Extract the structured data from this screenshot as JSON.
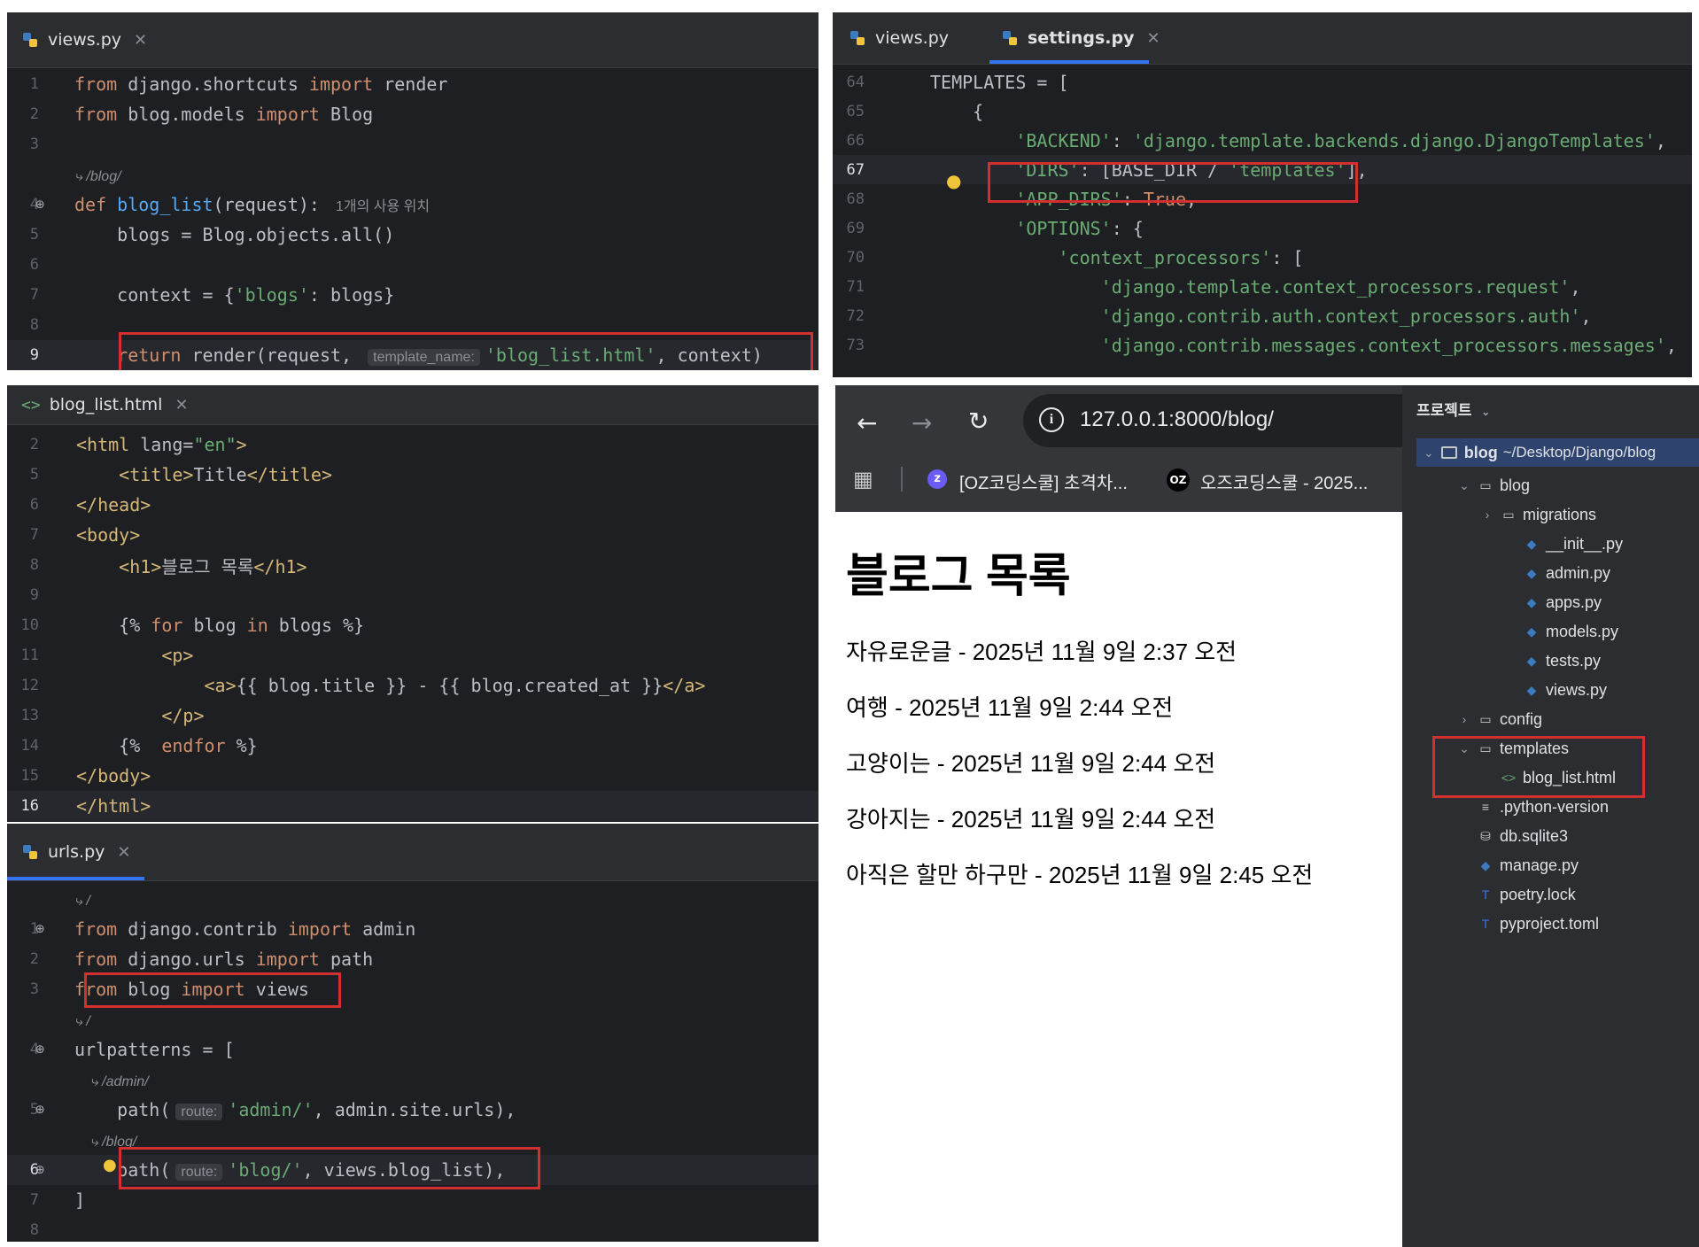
{
  "views_panel": {
    "tab": "views.py",
    "lines": [
      {
        "n": "1",
        "tokens": [
          [
            "kw",
            "from"
          ],
          [
            "",
            " django.shortcuts "
          ],
          [
            "kw",
            "import"
          ],
          [
            "",
            " render"
          ]
        ]
      },
      {
        "n": "2",
        "tokens": [
          [
            "kw",
            "from"
          ],
          [
            "",
            " blog.models "
          ],
          [
            "kw",
            "import"
          ],
          [
            "",
            " Blog"
          ]
        ]
      },
      {
        "n": "3",
        "tokens": []
      },
      {
        "n": "",
        "link": "/blog/"
      },
      {
        "n": "4",
        "tokens": [
          [
            "kw",
            "def "
          ],
          [
            "fn",
            "blog_list"
          ],
          [
            "",
            "(request):"
          ]
        ],
        "usage": "1개의 사용 위치"
      },
      {
        "n": "5",
        "tokens": [
          [
            "",
            "    blogs = Blog.objects.all()"
          ]
        ]
      },
      {
        "n": "6",
        "tokens": []
      },
      {
        "n": "7",
        "tokens": [
          [
            "",
            "    context = {"
          ],
          [
            "str",
            "'blogs'"
          ],
          [
            "",
            ": blogs}"
          ]
        ]
      },
      {
        "n": "8",
        "tokens": []
      },
      {
        "n": "9",
        "tokens": [
          [
            "",
            "    "
          ],
          [
            "kw",
            "return"
          ],
          [
            "",
            " render(request, "
          ],
          [
            "hint",
            "template_name:"
          ],
          [
            "str",
            "'blog_list.html'"
          ],
          [
            "",
            ", context)"
          ]
        ]
      }
    ]
  },
  "html_panel": {
    "tab": "blog_list.html",
    "lines": [
      {
        "n": "2",
        "tokens": [
          [
            "tag",
            "<html"
          ],
          [
            "",
            " lang="
          ],
          [
            "str",
            "\"en\""
          ],
          [
            "tag",
            ">"
          ]
        ]
      },
      {
        "n": "5",
        "tokens": [
          [
            "",
            "    "
          ],
          [
            "tag",
            "<title>"
          ],
          [
            "",
            "Title"
          ],
          [
            "tag",
            "</title>"
          ]
        ]
      },
      {
        "n": "6",
        "tokens": [
          [
            "tag",
            "</head>"
          ]
        ]
      },
      {
        "n": "7",
        "tokens": [
          [
            "tag",
            "<body>"
          ]
        ]
      },
      {
        "n": "8",
        "tokens": [
          [
            "",
            "    "
          ],
          [
            "tag",
            "<h1>"
          ],
          [
            "",
            "블로그 목록"
          ],
          [
            "tag",
            "</h1>"
          ]
        ]
      },
      {
        "n": "9",
        "tokens": []
      },
      {
        "n": "10",
        "tokens": [
          [
            "",
            "    {% "
          ],
          [
            "kw",
            "for"
          ],
          [
            "",
            " blog "
          ],
          [
            "kw",
            "in"
          ],
          [
            "",
            " blogs %}"
          ]
        ]
      },
      {
        "n": "11",
        "tokens": [
          [
            "",
            "        "
          ],
          [
            "tag",
            "<p>"
          ]
        ]
      },
      {
        "n": "12",
        "tokens": [
          [
            "",
            "            "
          ],
          [
            "tag",
            "<a>"
          ],
          [
            "",
            "{{ blog.title }} - {{ blog.created_at }}"
          ],
          [
            "tag",
            "</a>"
          ]
        ]
      },
      {
        "n": "13",
        "tokens": [
          [
            "",
            "        "
          ],
          [
            "tag",
            "</p>"
          ]
        ]
      },
      {
        "n": "14",
        "tokens": [
          [
            "",
            "    {%  "
          ],
          [
            "kw",
            "endfor"
          ],
          [
            "",
            " %}"
          ]
        ]
      },
      {
        "n": "15",
        "tokens": [
          [
            "tag",
            "</body>"
          ]
        ]
      },
      {
        "n": "16",
        "tokens": [
          [
            "tag",
            "</html>"
          ]
        ]
      }
    ]
  },
  "urls_panel": {
    "tab": "urls.py",
    "lines": [
      {
        "n": "",
        "link": "/"
      },
      {
        "n": "1",
        "tokens": [
          [
            "kw",
            "from"
          ],
          [
            "",
            " django.contrib "
          ],
          [
            "kw",
            "import"
          ],
          [
            "",
            " admin"
          ]
        ]
      },
      {
        "n": "2",
        "tokens": [
          [
            "kw",
            "from"
          ],
          [
            "",
            " django.urls "
          ],
          [
            "kw",
            "import"
          ],
          [
            "",
            " path"
          ]
        ]
      },
      {
        "n": "3",
        "tokens": [
          [
            "kw",
            "from"
          ],
          [
            "",
            " blog "
          ],
          [
            "kw",
            "import"
          ],
          [
            "",
            " views"
          ]
        ]
      },
      {
        "n": "",
        "link": "/"
      },
      {
        "n": "4",
        "tokens": [
          [
            "",
            "urlpatterns = ["
          ]
        ]
      },
      {
        "n": "",
        "link": "/admin/",
        "indent": true
      },
      {
        "n": "5",
        "tokens": [
          [
            "",
            "    path("
          ],
          [
            "hint",
            "route:"
          ],
          [
            "str",
            "'admin/'"
          ],
          [
            "",
            ", admin.site.urls),"
          ]
        ]
      },
      {
        "n": "",
        "link": "/blog/",
        "indent": true
      },
      {
        "n": "6",
        "tokens": [
          [
            "",
            "    path("
          ],
          [
            "hint",
            "route:"
          ],
          [
            "str",
            "'blog/'"
          ],
          [
            "",
            ", views.blog_list),"
          ]
        ]
      },
      {
        "n": "7",
        "tokens": [
          [
            "",
            "]"
          ]
        ]
      },
      {
        "n": "8",
        "tokens": []
      }
    ]
  },
  "settings_panel": {
    "tabs": [
      "views.py",
      "settings.py"
    ],
    "lines": [
      {
        "n": "64",
        "tokens": [
          [
            "",
            "TEMPLATES = ["
          ]
        ]
      },
      {
        "n": "65",
        "tokens": [
          [
            "",
            "    {"
          ]
        ]
      },
      {
        "n": "66",
        "tokens": [
          [
            "",
            "        "
          ],
          [
            "str",
            "'BACKEND'"
          ],
          [
            "",
            ": "
          ],
          [
            "str",
            "'django.template.backends.django.DjangoTemplates'"
          ],
          [
            "",
            ","
          ]
        ]
      },
      {
        "n": "67",
        "tokens": [
          [
            "",
            "        "
          ],
          [
            "str",
            "'DIRS'"
          ],
          [
            "",
            ": [BASE_DIR / "
          ],
          [
            "str",
            "'templates'"
          ],
          [
            "",
            "],"
          ]
        ]
      },
      {
        "n": "68",
        "tokens": [
          [
            "",
            "        "
          ],
          [
            "str",
            "'APP_DIRS'"
          ],
          [
            "",
            ": "
          ],
          [
            "kw",
            "True"
          ],
          [
            "",
            ","
          ]
        ]
      },
      {
        "n": "69",
        "tokens": [
          [
            "",
            "        "
          ],
          [
            "str",
            "'OPTIONS'"
          ],
          [
            "",
            ": {"
          ]
        ]
      },
      {
        "n": "70",
        "tokens": [
          [
            "",
            "            "
          ],
          [
            "str",
            "'context_processors'"
          ],
          [
            "",
            ": ["
          ]
        ]
      },
      {
        "n": "71",
        "tokens": [
          [
            "",
            "                "
          ],
          [
            "str",
            "'django.template.context_processors.request'"
          ],
          [
            "",
            ","
          ]
        ]
      },
      {
        "n": "72",
        "tokens": [
          [
            "",
            "                "
          ],
          [
            "str",
            "'django.contrib.auth.context_processors.auth'"
          ],
          [
            "",
            ","
          ]
        ]
      },
      {
        "n": "73",
        "tokens": [
          [
            "",
            "                "
          ],
          [
            "str",
            "'django.contrib.messages.context_processors.messages'"
          ],
          [
            "",
            ","
          ]
        ]
      }
    ]
  },
  "browser": {
    "url": "127.0.0.1:8000/blog/",
    "bookmark1": "[OZ코딩스쿨] 초격차...",
    "bookmark2": "오즈코딩스쿨 - 2025...",
    "bookmark2_logo": "OZ",
    "heading": "블로그 목록",
    "posts": [
      "자유로운글 - 2025년 11월 9일 2:37 오전",
      "여행 - 2025년 11월 9일 2:44 오전",
      "고양이는 - 2025년 11월 9일 2:44 오전",
      "강아지는 - 2025년 11월 9일 2:44 오전",
      "아직은 할만 하구만 - 2025년 11월 9일 2:45 오전"
    ]
  },
  "project": {
    "title": "프로젝트",
    "root_name": "blog",
    "root_path": "~/Desktop/Django/blog",
    "items": [
      {
        "label": "blog",
        "level": 1,
        "arrow": "down",
        "icon": "folder"
      },
      {
        "label": "migrations",
        "level": 2,
        "arrow": "right",
        "icon": "folder"
      },
      {
        "label": "__init__.py",
        "level": 3,
        "arrow": "",
        "icon": "python"
      },
      {
        "label": "admin.py",
        "level": 3,
        "arrow": "",
        "icon": "python"
      },
      {
        "label": "apps.py",
        "level": 3,
        "arrow": "",
        "icon": "python"
      },
      {
        "label": "models.py",
        "level": 3,
        "arrow": "",
        "icon": "python"
      },
      {
        "label": "tests.py",
        "level": 3,
        "arrow": "",
        "icon": "python"
      },
      {
        "label": "views.py",
        "level": 3,
        "arrow": "",
        "icon": "python"
      },
      {
        "label": "config",
        "level": 1,
        "arrow": "right",
        "icon": "folder"
      },
      {
        "label": "templates",
        "level": 1,
        "arrow": "down",
        "icon": "folder"
      },
      {
        "label": "blog_list.html",
        "level": 2,
        "arrow": "",
        "icon": "html"
      },
      {
        "label": ".python-version",
        "level": 1,
        "arrow": "",
        "icon": "text"
      },
      {
        "label": "db.sqlite3",
        "level": 1,
        "arrow": "",
        "icon": "database"
      },
      {
        "label": "manage.py",
        "level": 1,
        "arrow": "",
        "icon": "python"
      },
      {
        "label": "poetry.lock",
        "level": 1,
        "arrow": "",
        "icon": "toml"
      },
      {
        "label": "pyproject.toml",
        "level": 1,
        "arrow": "",
        "icon": "toml"
      }
    ]
  },
  "colors": {
    "highlight_box": "#d32f2f",
    "tab_underline": "#3574f0",
    "editor_bg": "#1e1f22"
  }
}
